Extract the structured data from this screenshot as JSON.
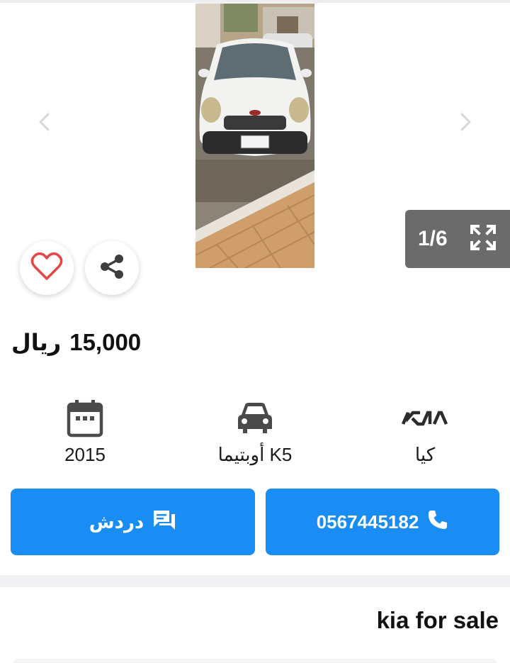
{
  "gallery": {
    "counter": "1/6",
    "prev_icon": "chevron-left-icon",
    "next_icon": "chevron-right-icon",
    "fullscreen_icon": "expand-icon"
  },
  "actions": {
    "favorite_icon": "heart-outline-icon",
    "share_icon": "share-icon"
  },
  "price": {
    "amount": "15,000",
    "currency": "ريال"
  },
  "specs": {
    "year": "2015",
    "model": "أوبتيما K5",
    "make": "كيا",
    "year_icon": "calendar-icon",
    "model_icon": "car-icon",
    "make_icon": "kia-logo"
  },
  "buttons": {
    "chat_label": "دردش",
    "call_number": "0567445182",
    "chat_icon": "chat-icon",
    "call_icon": "phone-icon"
  },
  "listing": {
    "title": "kia for sale"
  },
  "colors": {
    "primary": "#1a8df5",
    "favorite": "#e64545",
    "counter_bg": "#6b6b6b"
  }
}
